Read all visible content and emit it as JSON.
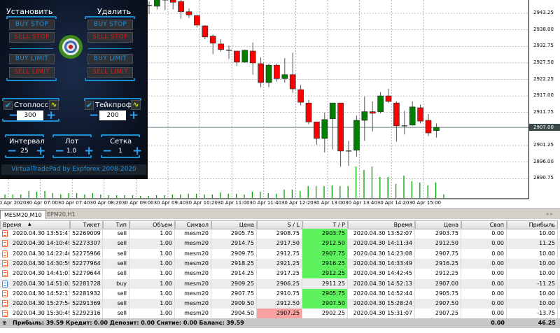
{
  "panel": {
    "set_title": "Установить",
    "remove_title": "Удалить",
    "buy_stop": "BUY STOP",
    "sell_stop": "SELL STOP",
    "buy_limit": "BUY LIMIT",
    "sell_limit": "SELL LIMIT",
    "stoploss_label": "Стоплосс",
    "stoploss_checked": true,
    "stoploss_value": "300",
    "takeprofit_label": "Тейкпроф",
    "takeprofit_checked": true,
    "takeprofit_value": "200",
    "interval_label": "Интервал",
    "interval_value": "25",
    "lot_label": "Лот",
    "lot_value": "1.0",
    "grid_label": "Сетка",
    "grid_value": "1",
    "footer": "VirtualTradePad by Expforex 2008-2020",
    "colors": {
      "buy": "#1e8fe0",
      "sell": "#e01818",
      "accent": "#1a8fd0"
    }
  },
  "chart_data": {
    "type": "candlestick",
    "symbol": "MESM20,M10",
    "price_ticks": [
      "2943.25",
      "2938.00",
      "2932.75",
      "2927.50",
      "2922.25",
      "2917.00",
      "2911.75",
      "2907.00",
      "2901.25",
      "2896.00",
      "2890.75"
    ],
    "current_price": "2907.00",
    "time_ticks": [
      "0 Apr 2020",
      "30 Apr 07:00",
      "30 Apr 07:40",
      "30 Apr 08:20",
      "30 Apr 09:00",
      "30 Apr 09:40",
      "30 Apr 10:20",
      "30 Apr 11:00",
      "30 Apr 11:40",
      "30 Apr 12:20",
      "30 Apr 13:00",
      "30 Apr 13:40",
      "30 Apr 14:20",
      "30 Apr 15:00"
    ],
    "ohlc": [
      [
        2945.75,
        2947,
        2943,
        2945.75
      ],
      [
        2945.5,
        2948,
        2944.5,
        2947.5
      ],
      [
        2947.5,
        2948,
        2944.25,
        2947.5
      ],
      [
        2947.5,
        2948,
        2944.5,
        2946.75
      ],
      [
        2947,
        2947.5,
        2941.5,
        2943.75
      ],
      [
        2943.75,
        2944.75,
        2941.75,
        2942.75
      ],
      [
        2942.5,
        2942.75,
        2938.75,
        2939.5
      ],
      [
        2939.25,
        2939.5,
        2935,
        2935.75
      ],
      [
        2936,
        2936.5,
        2930.25,
        2933.75
      ],
      [
        2933.5,
        2935,
        2931,
        2931.75
      ],
      [
        2931.5,
        2933,
        2928.75,
        2931.25
      ],
      [
        2931.25,
        2931.25,
        2926.5,
        2927.75
      ],
      [
        2927.75,
        2931.75,
        2927.5,
        2931.5
      ],
      [
        2931.25,
        2934,
        2923.75,
        2927.5
      ],
      [
        2927.25,
        2929.25,
        2919.75,
        2921.25
      ],
      [
        2921.25,
        2927.25,
        2919.75,
        2926.75
      ],
      [
        2926.75,
        2927.25,
        2921.5,
        2922.5
      ],
      [
        2922.5,
        2929,
        2921.25,
        2923.75
      ],
      [
        2923.75,
        2930.75,
        2918,
        2919.25
      ],
      [
        2919,
        2920.5,
        2914,
        2915
      ],
      [
        2914.75,
        2915.75,
        2908,
        2908.75
      ],
      [
        2908.75,
        2908.75,
        2901.5,
        2903.5
      ],
      [
        2903.5,
        2911.75,
        2899,
        2909.5
      ],
      [
        2909.75,
        2914.75,
        2900,
        2914.75
      ],
      [
        2914.75,
        2914.75,
        2894.5,
        2899.5
      ],
      [
        2899.5,
        2902.75,
        2894.75,
        2899.5
      ],
      [
        2899.75,
        2910.75,
        2897.75,
        2909.25
      ],
      [
        2909.25,
        2916.75,
        2902.75,
        2912
      ],
      [
        2912,
        2915.25,
        2905.75,
        2911.5
      ],
      [
        2912,
        2918.25,
        2911.5,
        2917
      ],
      [
        2917,
        2919.25,
        2914.75,
        2915.25
      ],
      [
        2914.75,
        2915.25,
        2902.5,
        2907.5
      ],
      [
        2907.5,
        2912.25,
        2904.75,
        2907.25
      ],
      [
        2907.75,
        2915.25,
        2907.5,
        2913.5
      ],
      [
        2913.25,
        2914.25,
        2908.25,
        2909
      ],
      [
        2909.25,
        2911.25,
        2904.25,
        2905.25
      ],
      [
        2906,
        2908.25,
        2903.75,
        2907
      ]
    ],
    "volume": [
      5,
      5,
      5,
      10,
      9,
      10,
      7,
      5,
      7,
      7,
      5,
      7,
      5,
      4,
      4,
      4,
      4,
      3,
      3,
      4,
      4,
      5,
      5,
      6,
      6,
      5,
      5,
      8,
      6,
      6,
      5,
      9,
      9,
      7,
      6,
      12,
      12,
      10,
      17,
      17,
      17,
      18,
      17,
      17,
      45,
      40,
      45,
      30,
      30,
      20,
      32,
      24,
      22,
      18,
      22,
      5
    ],
    "colors": {
      "up": "#008000",
      "down": "#ff0000",
      "volume": "#00a000",
      "grid": "#708090"
    }
  },
  "tabs": [
    {
      "label": "MESM20,M10",
      "active": true
    },
    {
      "label": "EPM20,H1",
      "active": false
    }
  ],
  "table": {
    "columns": [
      "Время",
      "Тикет",
      "Тип",
      "Объем",
      "Символ",
      "Цена",
      "S / L",
      "T / P",
      "Время",
      "Цена",
      "Своп",
      "Прибыль"
    ],
    "rows": [
      {
        "type_icon": "sell",
        "cells": [
          "2020.04.30 13:51:47",
          "52269009",
          "sell",
          "1.00",
          "mesm20",
          "2905.75",
          "2908.75",
          "2903.75",
          "2020.04.30 13:52:07",
          "2903.75",
          "0.00",
          "10.00"
        ],
        "hit": "tp"
      },
      {
        "type_icon": "sell",
        "cells": [
          "2020.04.30 14:10:49",
          "52273307",
          "sell",
          "1.00",
          "mesm20",
          "2914.75",
          "2917.50",
          "2912.50",
          "2020.04.30 14:11:34",
          "2912.50",
          "0.00",
          "11.25"
        ],
        "hit": "tp"
      },
      {
        "type_icon": "sell",
        "cells": [
          "2020.04.30 14:22:46",
          "52275966",
          "sell",
          "1.00",
          "mesm20",
          "2909.75",
          "2912.75",
          "2907.75",
          "2020.04.30 14:23:08",
          "2907.75",
          "0.00",
          "10.00"
        ],
        "hit": "tp"
      },
      {
        "type_icon": "sell",
        "cells": [
          "2020.04.30 14:30:59",
          "52277964",
          "sell",
          "1.00",
          "mesm20",
          "2918.25",
          "2921.25",
          "2916.25",
          "2020.04.30 14:33:49",
          "2916.25",
          "0.00",
          "10.00"
        ],
        "hit": "tp"
      },
      {
        "type_icon": "sell",
        "cells": [
          "2020.04.30 14:41:01",
          "52279644",
          "sell",
          "1.00",
          "mesm20",
          "2914.25",
          "2917.25",
          "2912.25",
          "2020.04.30 14:42:45",
          "2912.25",
          "0.00",
          "10.00"
        ],
        "hit": "tp"
      },
      {
        "type_icon": "buy",
        "cells": [
          "2020.04.30 14:51:02",
          "52281728",
          "buy",
          "1.00",
          "mesm20",
          "2909.25",
          "2906.25",
          "2911.25",
          "2020.04.30 14:52:13",
          "2907.00",
          "0.00",
          "-11.25"
        ],
        "hit": ""
      },
      {
        "type_icon": "sell",
        "cells": [
          "2020.04.30 14:52:17",
          "52281932",
          "sell",
          "1.00",
          "mesm20",
          "2907.75",
          "2910.75",
          "2905.75",
          "2020.04.30 14:52:44",
          "2905.75",
          "0.00",
          "10.00"
        ],
        "hit": "tp"
      },
      {
        "type_icon": "sell",
        "cells": [
          "2020.04.30 15:27:54",
          "52291369",
          "sell",
          "1.00",
          "mesm20",
          "2909.50",
          "2912.50",
          "2907.50",
          "2020.04.30 15:28:24",
          "2907.50",
          "0.00",
          "10.00"
        ],
        "hit": "tp"
      },
      {
        "type_icon": "sell",
        "cells": [
          "2020.04.30 15:30:49",
          "52292316",
          "sell",
          "1.00",
          "mesm20",
          "2904.50",
          "2907.25",
          "2902.25",
          "2020.04.30 15:31:07",
          "2907.25",
          "0.00",
          "-13.75"
        ],
        "hit": "sl"
      }
    ],
    "summary": "Прибыль: 39.59  Кредит: 0.00  Депозит: 0.00  Снятие: 0.00  Баланс: 39.59",
    "total_swap": "0.00",
    "total_profit": "46.25"
  }
}
